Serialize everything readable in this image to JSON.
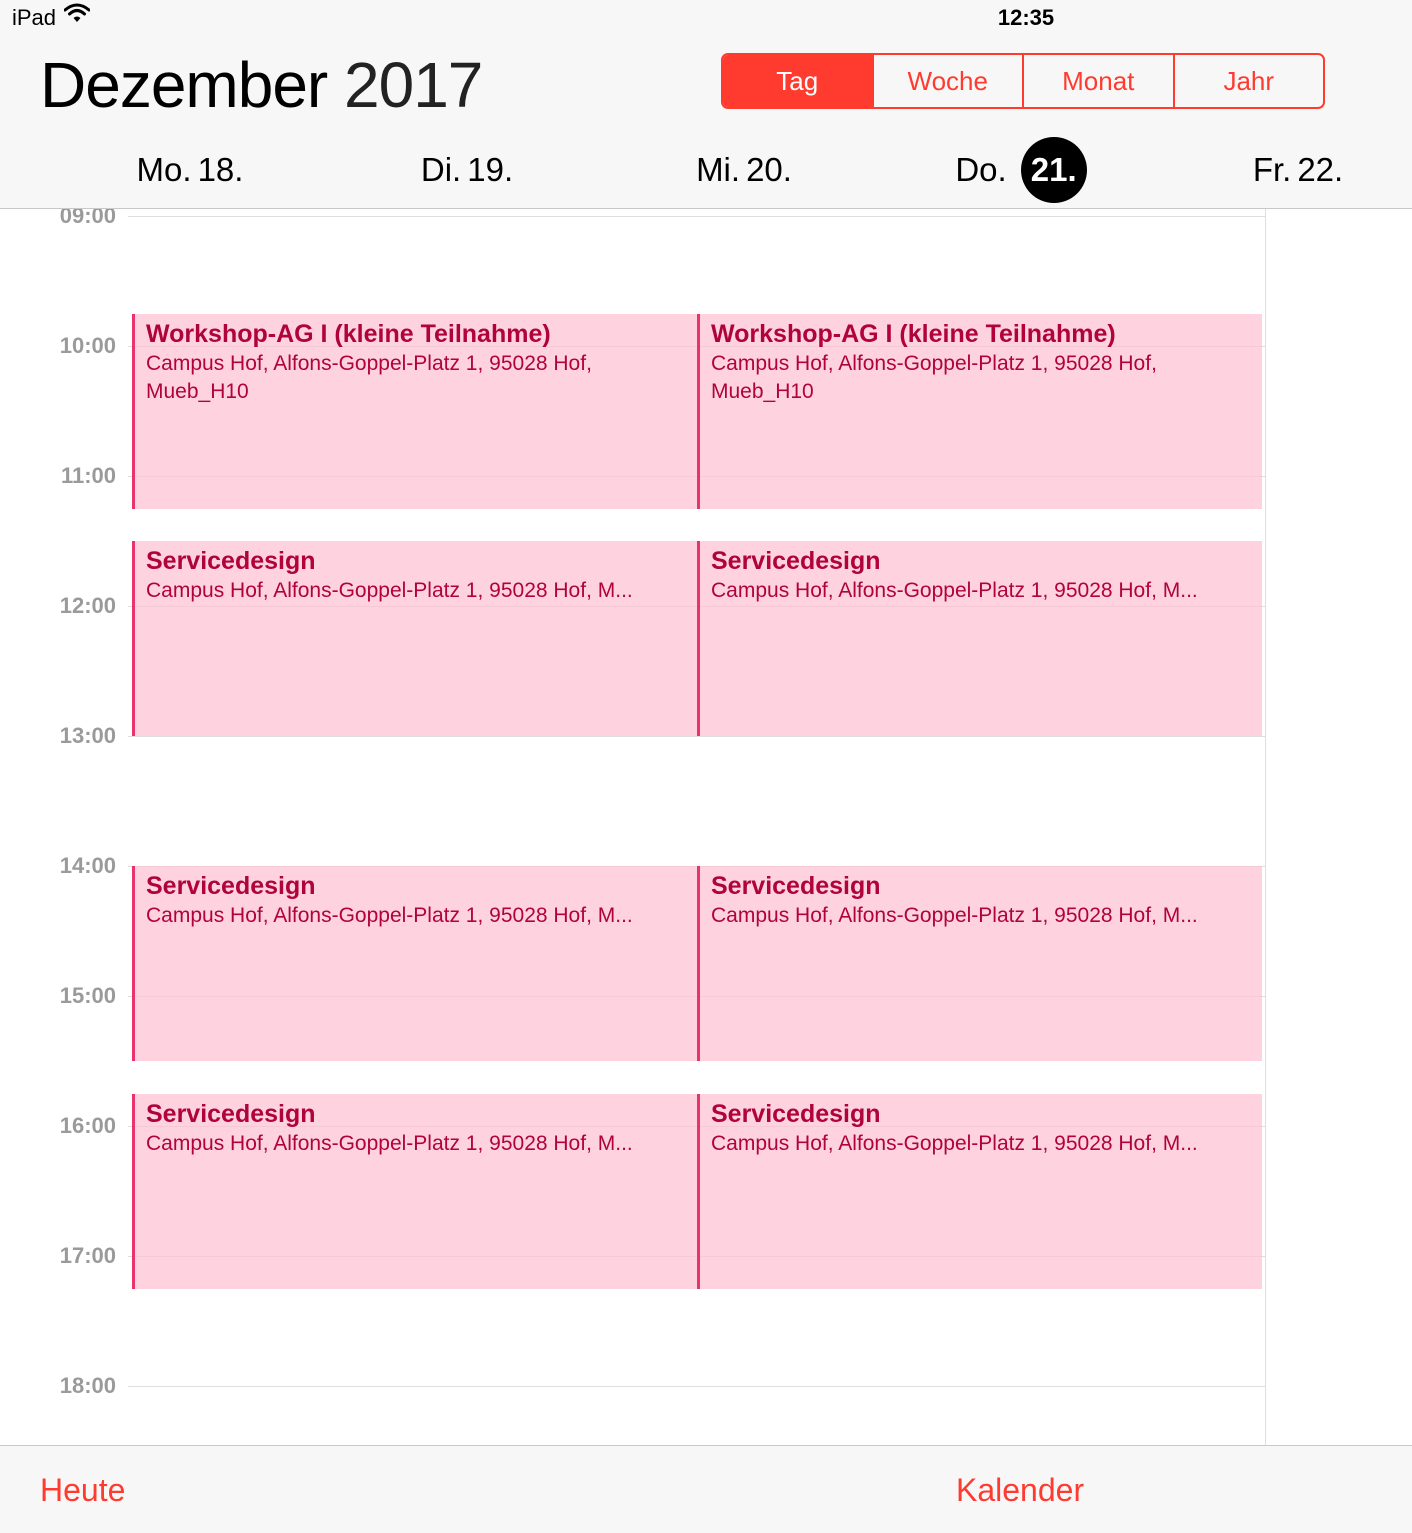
{
  "status_bar": {
    "device": "iPad",
    "wifi_icon": "wifi-icon",
    "time": "12:35"
  },
  "header": {
    "month": "Dezember",
    "year": "2017"
  },
  "view_modes": [
    "Tag",
    "Woche",
    "Monat",
    "Jahr"
  ],
  "active_view": "Tag",
  "days": [
    {
      "weekday": "Mo.",
      "num": "18."
    },
    {
      "weekday": "Di.",
      "num": "19."
    },
    {
      "weekday": "Mi.",
      "num": "20."
    },
    {
      "weekday": "Do.",
      "num": "21.",
      "today": true
    },
    {
      "weekday": "Fr.",
      "num": "22."
    }
  ],
  "hours": [
    "09:00",
    "10:00",
    "11:00",
    "12:00",
    "13:00",
    "14:00",
    "15:00",
    "16:00",
    "17:00",
    "18:00"
  ],
  "events": [
    {
      "title": "Workshop-AG I (kleine Teilnahme)",
      "location": "Campus Hof, Alfons-Goppel-Platz 1, 95028 Hof, Mueb_H10",
      "start": "09:45",
      "end": "11:15"
    },
    {
      "title": "Workshop-AG I (kleine Teilnahme)",
      "location": "Campus Hof, Alfons-Goppel-Platz 1, 95028 Hof, Mueb_H10",
      "start": "09:45",
      "end": "11:15"
    },
    {
      "title": "Servicedesign",
      "location": "Campus Hof, Alfons-Goppel-Platz 1, 95028 Hof, M...",
      "start": "11:30",
      "end": "13:00"
    },
    {
      "title": "Servicedesign",
      "location": "Campus Hof, Alfons-Goppel-Platz 1, 95028 Hof, M...",
      "start": "11:30",
      "end": "13:00"
    },
    {
      "title": "Servicedesign",
      "location": "Campus Hof, Alfons-Goppel-Platz 1, 95028 Hof, M...",
      "start": "14:00",
      "end": "15:30"
    },
    {
      "title": "Servicedesign",
      "location": "Campus Hof, Alfons-Goppel-Platz 1, 95028 Hof, M...",
      "start": "14:00",
      "end": "15:30"
    },
    {
      "title": "Servicedesign",
      "location": "Campus Hof, Alfons-Goppel-Platz 1, 95028 Hof, M...",
      "start": "15:45",
      "end": "17:15"
    },
    {
      "title": "Servicedesign",
      "location": "Campus Hof, Alfons-Goppel-Platz 1, 95028 Hof, M...",
      "start": "15:45",
      "end": "17:15"
    }
  ],
  "footer": {
    "today_label": "Heute",
    "calendars_label": "Kalender"
  },
  "colors": {
    "accent": "#ff3b30",
    "event_bg": "#fdd3df",
    "event_bar": "#e8336e",
    "event_text": "#b0033c"
  }
}
